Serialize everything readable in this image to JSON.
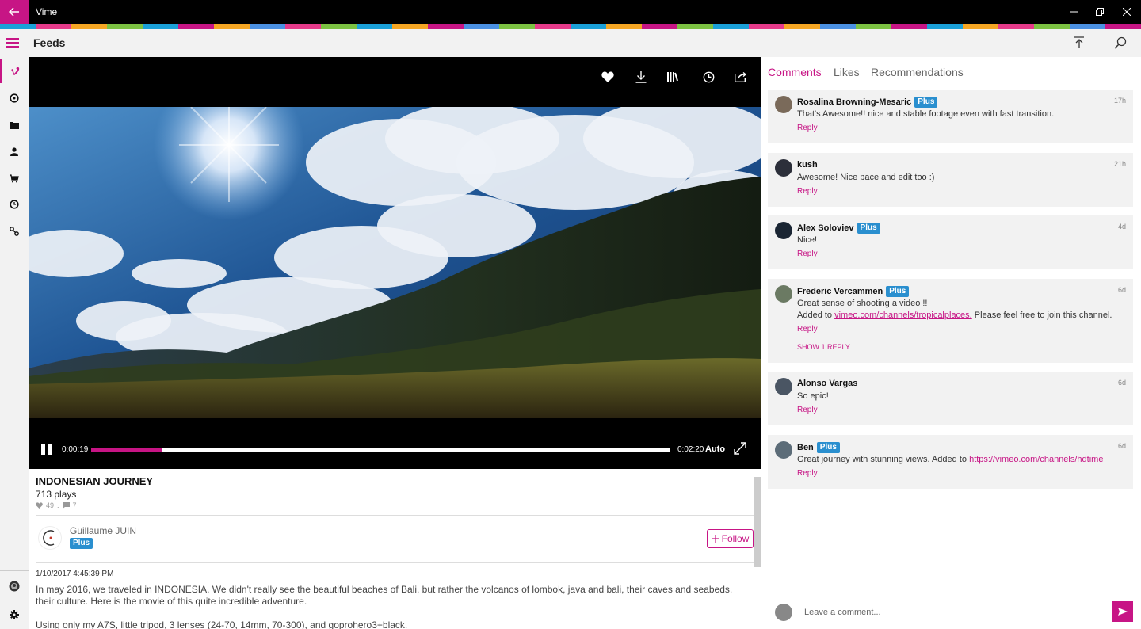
{
  "window": {
    "title": "Vime"
  },
  "appbar": {
    "title": "Feeds"
  },
  "stripe_colors": [
    "#1aa0d8",
    "#e63a8a",
    "#f5a623",
    "#7cc242",
    "#1aa0d8",
    "#c71585",
    "#f5a623",
    "#4a90e2",
    "#e63a8a",
    "#7cc242",
    "#1aa0d8",
    "#f5a623",
    "#c71585",
    "#4a90e2",
    "#7cc242",
    "#e63a8a",
    "#1aa0d8",
    "#f5a623",
    "#c71585",
    "#7cc242",
    "#1aa0d8",
    "#e63a8a",
    "#f5a623",
    "#4a90e2",
    "#7cc242",
    "#c71585",
    "#1aa0d8",
    "#f5a623",
    "#e63a8a",
    "#7cc242",
    "#4a90e2",
    "#c71585"
  ],
  "accent": "#c71585",
  "nav": [
    {
      "icon": "vimeo-logo-icon",
      "active": true
    },
    {
      "icon": "explore-icon"
    },
    {
      "icon": "folder-icon"
    },
    {
      "icon": "user-icon"
    },
    {
      "icon": "cart-icon"
    },
    {
      "icon": "history-icon"
    },
    {
      "icon": "link-icon"
    }
  ],
  "nav_bottom": [
    {
      "icon": "account-avatar-icon"
    },
    {
      "icon": "settings-icon"
    }
  ],
  "player": {
    "actions": [
      "like-icon",
      "download-icon",
      "add-to-collection-icon",
      "watch-later-icon",
      "share-icon"
    ],
    "current_time": "0:00:19",
    "total_time": "0:02:20",
    "quality": "Auto",
    "progress": 0.122
  },
  "video": {
    "title": "INDONESIAN JOURNEY",
    "plays": "713 plays",
    "likes": "49",
    "comments_count": "7",
    "author": {
      "name": "Guillaume JUIN",
      "badge": "Plus"
    },
    "follow_label": "Follow",
    "date": "1/10/2017 4:45:39 PM",
    "description": [
      "In may 2016, we traveled in INDONESIA. We didn't really see the beautiful beaches of Bali, but rather the volcanos of lombok, java and bali, their caves and seabeds, their culture. Here is the movie of this quite incredible adventure.",
      "Using only my A7S, little tripod, 3 lenses (24-70, 14mm, 70-300), and goprohero3+black."
    ]
  },
  "tabs": [
    "Comments",
    "Likes",
    "Recommendations"
  ],
  "comments": [
    {
      "name": "Rosalina Browning-Mesaric",
      "plus": "Plus",
      "time": "17h",
      "text": "That's Awesome!! nice and stable footage even with fast transition.",
      "reply": "Reply"
    },
    {
      "name": "kush",
      "time": "21h",
      "text": "Awesome! Nice pace and edit too :)",
      "reply": "Reply"
    },
    {
      "name": "Alex Soloviev",
      "plus": "Plus",
      "time": "4d",
      "text": "Nice!",
      "reply": "Reply"
    },
    {
      "name": "Frederic Vercammen",
      "plus": "Plus",
      "time": "6d",
      "text": "Great sense of shooting a video !!",
      "text2_pre": "Added to ",
      "text2_link": "vimeo.com/channels/tropicalplaces.",
      "text2_post": " Please feel free to join this channel.",
      "reply": "Reply",
      "show_replies": "SHOW 1 REPLY"
    },
    {
      "name": "Alonso Vargas",
      "time": "6d",
      "text": "So epic!",
      "reply": "Reply"
    },
    {
      "name": "Ben",
      "plus": "Plus",
      "time": "6d",
      "text_pre": "Great journey with stunning views. Added to ",
      "text_link": "https://vimeo.com/channels/hdtime",
      "reply": "Reply"
    }
  ],
  "comment_box": {
    "placeholder": "Leave a comment..."
  }
}
